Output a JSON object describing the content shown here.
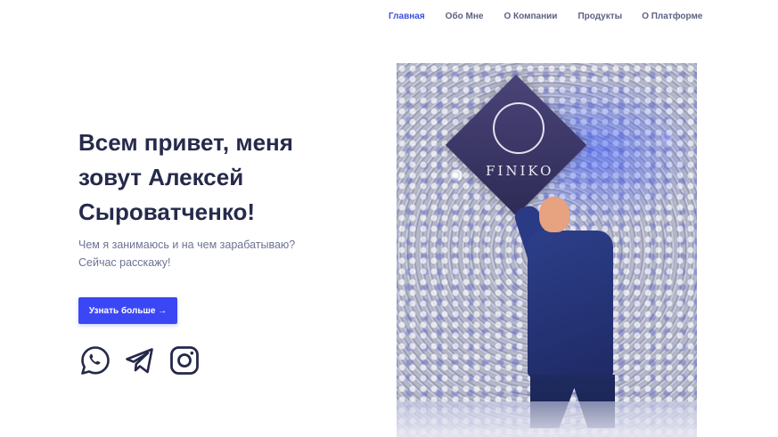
{
  "nav": {
    "items": [
      {
        "label": "Главная",
        "active": true
      },
      {
        "label": "Обо Мне",
        "active": false
      },
      {
        "label": "О Компании",
        "active": false
      },
      {
        "label": "Продукты",
        "active": false
      },
      {
        "label": "О Платформе",
        "active": false
      }
    ]
  },
  "hero": {
    "title": "Всем привет, меня зовут Алексей Сыроватченко!",
    "subtitle": "Чем я занимаюсь и на чем зарабатываю? Сейчас расскажу!",
    "cta_label": "Узнать больше →"
  },
  "socials": [
    {
      "icon": "whatsapp-icon"
    },
    {
      "icon": "telegram-icon"
    },
    {
      "icon": "instagram-icon"
    }
  ],
  "photo": {
    "sign_text": "FINIKO"
  },
  "colors": {
    "accent": "#3b47f5",
    "nav_active": "#3d4ee2",
    "heading": "#262a4b",
    "muted": "#6d7393"
  }
}
